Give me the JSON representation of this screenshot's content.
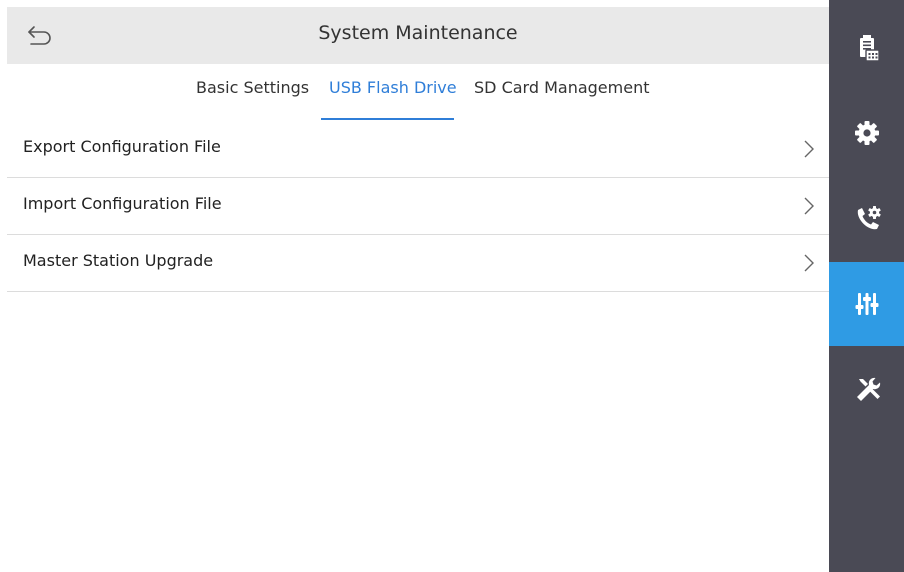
{
  "header": {
    "title": "System Maintenance"
  },
  "tabs": [
    {
      "label": "Basic Settings",
      "active": false
    },
    {
      "label": "USB Flash Drive",
      "active": true
    },
    {
      "label": "SD Card Management",
      "active": false
    }
  ],
  "list": [
    {
      "label": "Export Configuration File"
    },
    {
      "label": "Import Configuration File"
    },
    {
      "label": "Master Station Upgrade"
    }
  ],
  "sidebar": {
    "items": [
      {
        "icon": "device-icon",
        "active": false
      },
      {
        "icon": "gear-icon",
        "active": false
      },
      {
        "icon": "call-settings-icon",
        "active": false
      },
      {
        "icon": "sliders-icon",
        "active": true
      },
      {
        "icon": "tools-icon",
        "active": false
      }
    ]
  },
  "colors": {
    "accent": "#2f7ed8",
    "sidebar_bg": "#4a4a55",
    "sidebar_active": "#2f9be4",
    "header_bg": "#e9e9e9"
  }
}
